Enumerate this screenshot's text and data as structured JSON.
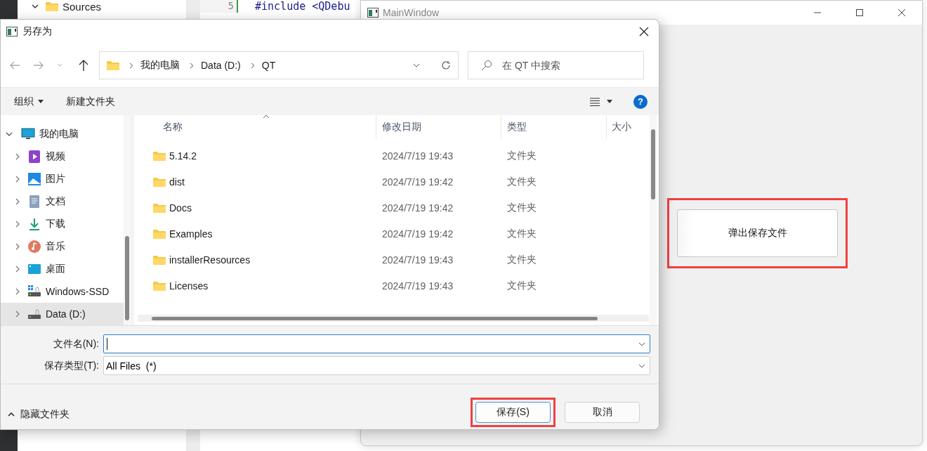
{
  "background_ide": {
    "tree_item": "Sources",
    "line_number": "5",
    "code": "#include <QDebu"
  },
  "main_window": {
    "title": "MainWindow",
    "button": {
      "label": "弹出保存文件",
      "highlighted": true
    }
  },
  "dialog": {
    "title": "另存为",
    "breadcrumb": [
      "我的电脑",
      "Data (D:)",
      "QT"
    ],
    "search": {
      "placeholder": "在 QT 中搜索"
    },
    "toolbar": [
      {
        "label": "组织",
        "dropdown": true
      },
      {
        "label": "新建文件夹",
        "dropdown": false
      }
    ],
    "help_button": "?",
    "sidebar": {
      "items": [
        {
          "label": "我的电脑",
          "kind": "monitor",
          "expanded": true,
          "selected": false,
          "children": [
            {
              "label": "视频",
              "kind": "video",
              "expanded": false,
              "selected": false
            },
            {
              "label": "图片",
              "kind": "picture",
              "expanded": false,
              "selected": false
            },
            {
              "label": "文档",
              "kind": "document",
              "expanded": false,
              "selected": false
            },
            {
              "label": "下载",
              "kind": "download",
              "expanded": false,
              "selected": false
            },
            {
              "label": "音乐",
              "kind": "music",
              "expanded": false,
              "selected": false
            },
            {
              "label": "桌面",
              "kind": "desktop",
              "expanded": false,
              "selected": false
            },
            {
              "label": "Windows-SSD",
              "kind": "system",
              "expanded": false,
              "selected": false
            },
            {
              "label": "Data (D:)",
              "kind": "drive",
              "expanded": false,
              "selected": true
            }
          ]
        }
      ]
    },
    "table": {
      "columns": [
        "名称",
        "修改日期",
        "类型",
        "大小"
      ],
      "rows": [
        {
          "name": "5.14.2",
          "modified": "2024/7/19 19:43",
          "type": "文件夹"
        },
        {
          "name": "dist",
          "modified": "2024/7/19 19:42",
          "type": "文件夹"
        },
        {
          "name": "Docs",
          "modified": "2024/7/19 19:42",
          "type": "文件夹"
        },
        {
          "name": "Examples",
          "modified": "2024/7/19 19:42",
          "type": "文件夹"
        },
        {
          "name": "installerResources",
          "modified": "2024/7/19 19:43",
          "type": "文件夹"
        },
        {
          "name": "Licenses",
          "modified": "2024/7/19 19:43",
          "type": "文件夹"
        }
      ]
    },
    "fields": [
      {
        "label": "文件名(N):",
        "focused": true
      },
      {
        "label": "保存类型(T):",
        "value": "All Files  (*)",
        "focused": false
      }
    ],
    "hide_folders": "隐藏文件夹",
    "buttons": [
      {
        "label": "保存(S)",
        "primary": true,
        "highlighted": true
      },
      {
        "label": "取消",
        "primary": false,
        "highlighted": false
      }
    ]
  }
}
